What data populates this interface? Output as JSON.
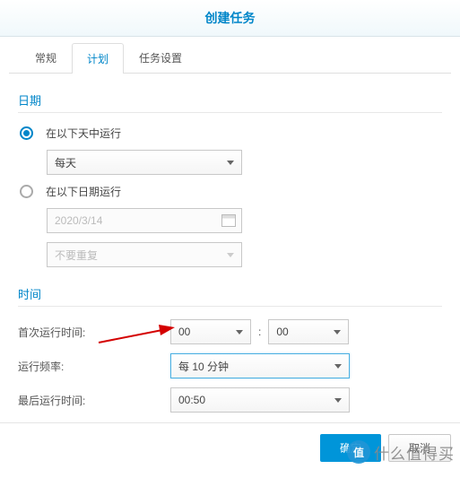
{
  "header": {
    "title": "创建任务"
  },
  "tabs": {
    "general": "常规",
    "schedule": "计划",
    "task_settings": "任务设置"
  },
  "date_section": {
    "title": "日期",
    "run_on_days_label": "在以下天中运行",
    "day_select": "每天",
    "run_on_date_label": "在以下日期运行",
    "date_value": "2020/3/14",
    "repeat_select": "不要重复"
  },
  "time_section": {
    "title": "时间",
    "first_run_label": "首次运行时间:",
    "first_hour": "00",
    "first_min": "00",
    "freq_label": "运行频率:",
    "freq_value": "每 10 分钟",
    "last_run_label": "最后运行时间:",
    "last_run_value": "00:50"
  },
  "footer": {
    "ok": "确定",
    "cancel": "取消"
  },
  "watermark": {
    "badge": "值",
    "text": "什么值得买"
  }
}
